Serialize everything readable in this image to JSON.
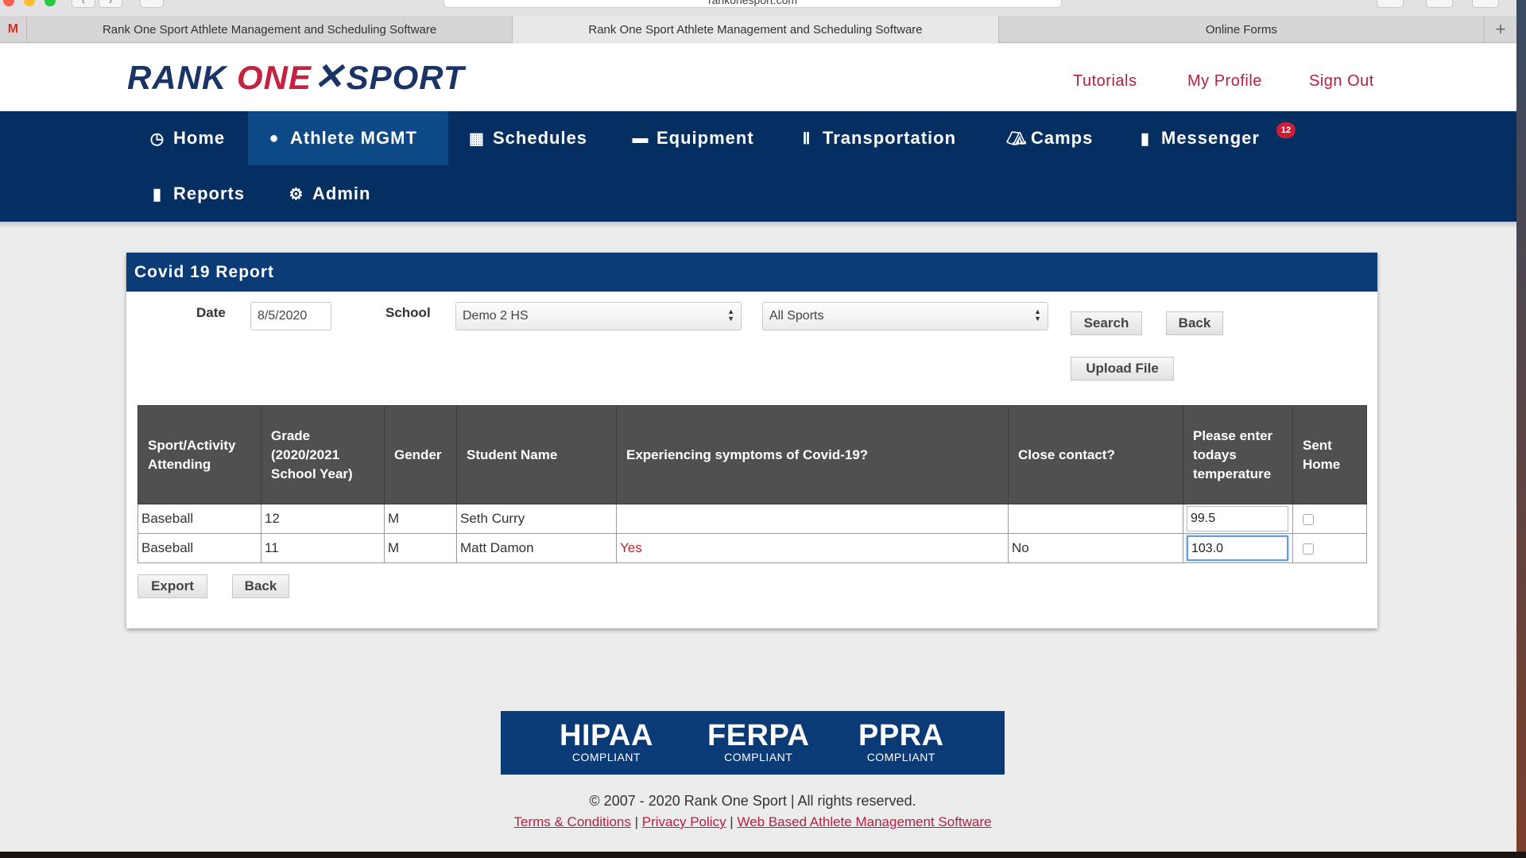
{
  "browser": {
    "url": "rankonesport.com",
    "tabs": [
      {
        "label": "Rank One Sport Athlete Management and Scheduling Software",
        "active": false
      },
      {
        "label": "Rank One Sport Athlete Management and Scheduling Software",
        "active": true
      },
      {
        "label": "Online Forms",
        "active": false
      }
    ],
    "favicon": "M",
    "new_tab": "+"
  },
  "header": {
    "logo": {
      "part1": "RANK ",
      "part2": "ONE",
      "part3": "SPORT"
    },
    "links": {
      "tutorials": "Tutorials",
      "profile": "My Profile",
      "signout": "Sign Out"
    }
  },
  "nav": {
    "home": "Home",
    "athlete": "Athlete MGMT",
    "schedules": "Schedules",
    "equipment": "Equipment",
    "transportation": "Transportation",
    "camps": "Camps",
    "messenger": "Messenger",
    "messenger_badge": "12",
    "reports": "Reports",
    "admin": "Admin"
  },
  "report": {
    "title": "Covid 19 Report",
    "date_label": "Date",
    "date_value": "8/5/2020",
    "school_label": "School",
    "school_value": "Demo 2 HS",
    "sport_value": "All Sports",
    "search_label": "Search",
    "back_label": "Back",
    "upload_label": "Upload File",
    "columns": {
      "c1": "Sport/Activity Attending",
      "c2": "Grade (2020/2021 School Year)",
      "c3": "Gender",
      "c4": "Student Name",
      "c5": "Experiencing symptoms of Covid-19?",
      "c6": "Close contact?",
      "c7": "Please enter todays temperature",
      "c8": "Sent Home"
    },
    "rows": [
      {
        "sport": "Baseball",
        "grade": "12",
        "gender": "M",
        "name": "Seth Curry",
        "symptoms": "",
        "contact": "",
        "temperature": "99.5"
      },
      {
        "sport": "Baseball",
        "grade": "11",
        "gender": "M",
        "name": "Matt Damon",
        "symptoms": "Yes",
        "contact": "No",
        "temperature": "103.0"
      }
    ],
    "export_label": "Export",
    "back2_label": "Back"
  },
  "compliance": {
    "hipaa": "HIPAA",
    "ferpa": "FERPA",
    "ppra": "PPRA",
    "compliant": "COMPLIANT"
  },
  "footer": {
    "copyright": "© 2007 - 2020 Rank One Sport | All rights reserved.",
    "terms": "Terms & Conditions",
    "privacy": "Privacy Policy",
    "web": "Web Based Athlete Management Software",
    "sep": " | "
  },
  "colors": {
    "brand_navy": "#062f61",
    "brand_red": "#b52140",
    "alert_red": "#c8232c"
  }
}
